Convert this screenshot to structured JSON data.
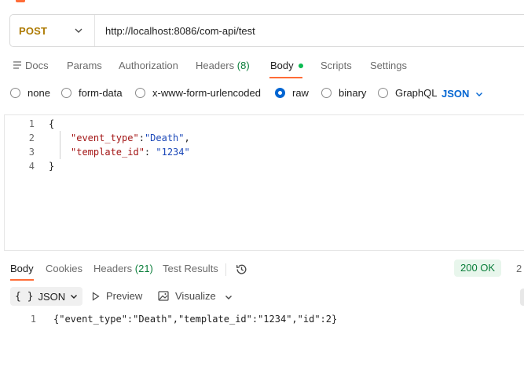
{
  "request": {
    "method": "POST",
    "url": "http://localhost:8086/com-api/test"
  },
  "tabs": [
    {
      "label": "Docs",
      "icon": "docs-icon"
    },
    {
      "label": "Params"
    },
    {
      "label": "Authorization"
    },
    {
      "label": "Headers",
      "count": "(8)"
    },
    {
      "label": "Body",
      "active": true,
      "indicator": "green-dot"
    },
    {
      "label": "Scripts"
    },
    {
      "label": "Settings"
    }
  ],
  "body_types": {
    "options": [
      "none",
      "form-data",
      "x-www-form-urlencoded",
      "raw",
      "binary",
      "GraphQL"
    ],
    "selected": "raw",
    "language": "JSON"
  },
  "editor": {
    "lines": [
      {
        "n": "1",
        "text": "{"
      },
      {
        "n": "2",
        "key": "\"event_type\"",
        "sep": ":",
        "value": "\"Death\"",
        "tail": ","
      },
      {
        "n": "3",
        "key": "\"template_id\"",
        "sep": ": ",
        "value": "\"1234\"",
        "tail": ""
      },
      {
        "n": "4",
        "text": "}"
      }
    ]
  },
  "response": {
    "tabs": [
      {
        "label": "Body",
        "active": true
      },
      {
        "label": "Cookies"
      },
      {
        "label": "Headers",
        "count": "(21)"
      },
      {
        "label": "Test Results"
      }
    ],
    "status": "200 OK",
    "status_extra": "2",
    "format": "JSON",
    "tools": [
      "Preview",
      "Visualize"
    ],
    "lines": [
      {
        "n": "1",
        "text": "{\"event_type\":\"Death\",\"template_id\":\"1234\",\"id\":2}"
      }
    ]
  },
  "colors": {
    "accent": "#FF6C37",
    "method": "#AD7A03",
    "selected_radio": "#0265D2",
    "status_ok": "#0A7E3A",
    "json_key": "#A31515",
    "json_string": "#1A47B8"
  }
}
